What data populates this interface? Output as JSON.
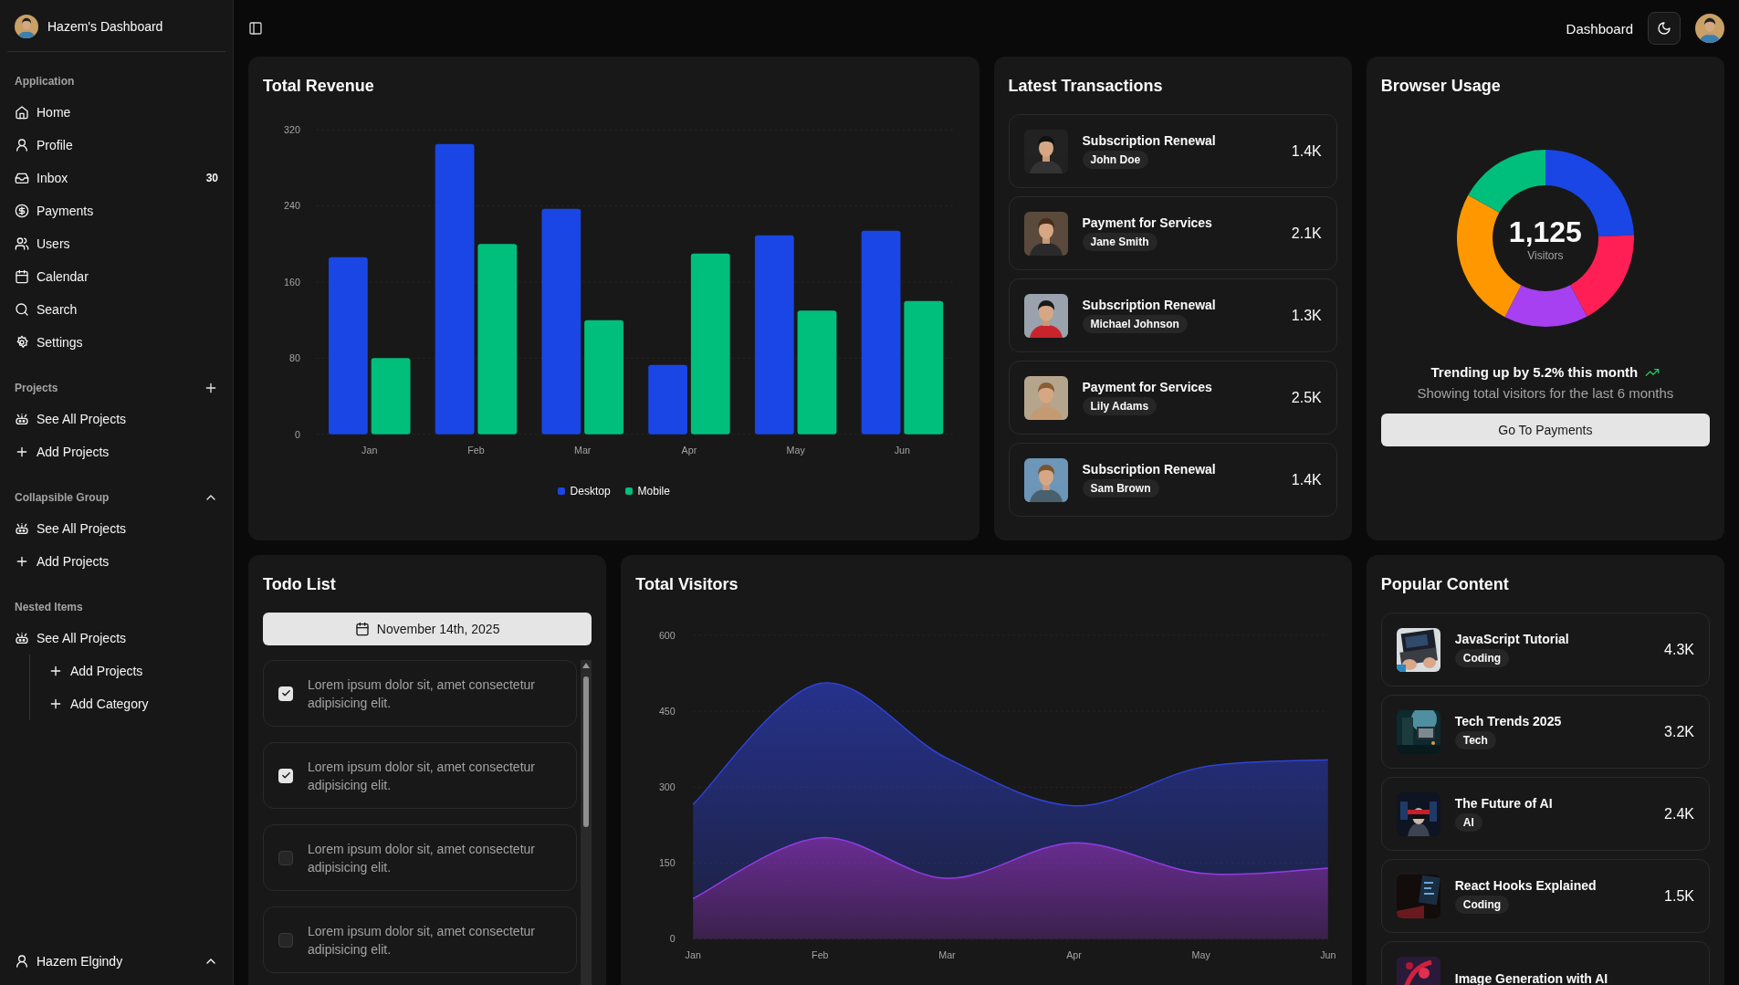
{
  "sidebar": {
    "title": "Hazem's Dashboard",
    "groups": [
      {
        "label": "Application",
        "kind": "plain",
        "items": [
          {
            "label": "Home"
          },
          {
            "label": "Profile"
          },
          {
            "label": "Inbox",
            "badge": "30"
          },
          {
            "label": "Payments"
          },
          {
            "label": "Users"
          },
          {
            "label": "Calendar"
          },
          {
            "label": "Search"
          },
          {
            "label": "Settings"
          }
        ]
      },
      {
        "label": "Projects",
        "kind": "add",
        "items": [
          {
            "label": "See All Projects"
          },
          {
            "label": "Add Projects"
          }
        ]
      },
      {
        "label": "Collapsible Group",
        "kind": "collapsible",
        "expanded": true,
        "items": [
          {
            "label": "See All Projects"
          },
          {
            "label": "Add Projects"
          }
        ]
      },
      {
        "label": "Nested Items",
        "kind": "plain",
        "items": [
          {
            "label": "See All Projects",
            "children": [
              {
                "label": "Add Projects"
              },
              {
                "label": "Add Category"
              }
            ]
          }
        ]
      }
    ],
    "user": {
      "name": "Hazem Elgindy"
    }
  },
  "header": {
    "title": "Dashboard"
  },
  "revenue": {
    "title": "Total Revenue",
    "chart_data": {
      "type": "bar",
      "grid": true,
      "categories": [
        "Jan",
        "Feb",
        "Mar",
        "Apr",
        "May",
        "Jun"
      ],
      "ylim": [
        0,
        320
      ],
      "yticks": [
        0,
        80,
        160,
        240,
        320
      ],
      "series": [
        {
          "name": "Desktop",
          "color": "#1a46e5",
          "values": [
            186,
            305,
            237,
            73,
            209,
            214
          ]
        },
        {
          "name": "Mobile",
          "color": "#00bf7d",
          "values": [
            80,
            200,
            120,
            190,
            130,
            140
          ]
        }
      ]
    }
  },
  "transactions": {
    "title": "Latest Transactions",
    "items": [
      {
        "title": "Subscription Renewal",
        "name": "John Doe",
        "amount": "1.4K"
      },
      {
        "title": "Payment for Services",
        "name": "Jane Smith",
        "amount": "2.1K"
      },
      {
        "title": "Subscription Renewal",
        "name": "Michael Johnson",
        "amount": "1.3K"
      },
      {
        "title": "Payment for Services",
        "name": "Lily Adams",
        "amount": "2.5K"
      },
      {
        "title": "Subscription Renewal",
        "name": "Sam Brown",
        "amount": "1.4K"
      }
    ]
  },
  "browser": {
    "title": "Browser Usage",
    "total": "1,125",
    "total_label": "Visitors",
    "trend": "Trending up by 5.2% this month",
    "note": "Showing total visitors for the last 6 months",
    "button": "Go To Payments"
  },
  "todo": {
    "title": "Todo List",
    "date": "November 14th, 2025",
    "items": [
      {
        "text": "Lorem ipsum dolor sit, amet consectetur adipisicing elit.",
        "checked": true
      },
      {
        "text": "Lorem ipsum dolor sit, amet consectetur adipisicing elit.",
        "checked": true
      },
      {
        "text": "Lorem ipsum dolor sit, amet consectetur adipisicing elit.",
        "checked": false
      },
      {
        "text": "Lorem ipsum dolor sit, amet consectetur adipisicing elit.",
        "checked": false
      }
    ]
  },
  "visitors": {
    "title": "Total Visitors",
    "chart_data": {
      "type": "area",
      "grid": true,
      "categories": [
        "Jan",
        "Feb",
        "Mar",
        "Apr",
        "May",
        "Jun"
      ],
      "ylim": [
        0,
        600
      ],
      "yticks": [
        0,
        150,
        300,
        450,
        600
      ],
      "stacked": true,
      "series": [
        {
          "color": "#a13be6",
          "values": [
            80,
            200,
            120,
            190,
            130,
            140
          ]
        },
        {
          "color": "#2f43d9",
          "values": [
            186,
            305,
            237,
            73,
            209,
            214
          ]
        }
      ]
    }
  },
  "popular": {
    "title": "Popular Content",
    "items": [
      {
        "title": "JavaScript Tutorial",
        "tag": "Coding",
        "views": "4.3K"
      },
      {
        "title": "Tech Trends 2025",
        "tag": "Tech",
        "views": "3.2K"
      },
      {
        "title": "The Future of AI",
        "tag": "AI",
        "views": "2.4K"
      },
      {
        "title": "React Hooks Explained",
        "tag": "Coding",
        "views": "1.5K"
      },
      {
        "title": "Image Generation with AI"
      }
    ]
  }
}
